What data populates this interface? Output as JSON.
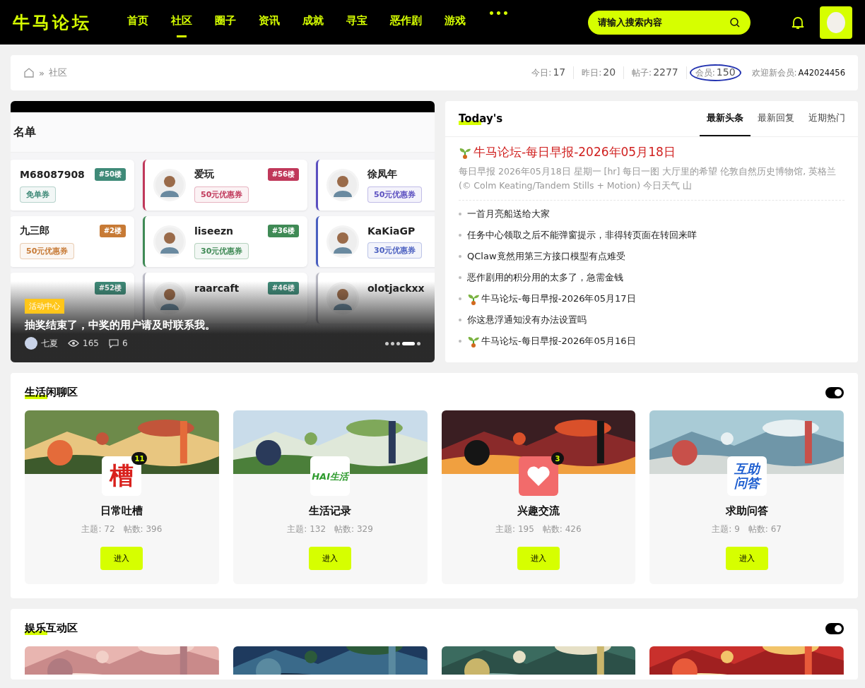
{
  "header": {
    "logo": "牛马论坛",
    "nav": [
      {
        "label": "首页",
        "selected": false
      },
      {
        "label": "社区",
        "selected": true
      },
      {
        "label": "圈子",
        "selected": false
      },
      {
        "label": "资讯",
        "selected": false
      },
      {
        "label": "成就",
        "selected": false
      },
      {
        "label": "寻宝",
        "selected": false
      },
      {
        "label": "恶作剧",
        "selected": false
      },
      {
        "label": "游戏",
        "selected": false
      }
    ],
    "more": "•••",
    "search": {
      "placeholder": "请输入搜索内容"
    }
  },
  "breadcrumb": {
    "separator": "»",
    "current": "社区"
  },
  "stats": [
    {
      "label": "今日:",
      "value": "17",
      "circled": false
    },
    {
      "label": "昨日:",
      "value": "20",
      "circled": false
    },
    {
      "label": "帖子:",
      "value": "2277",
      "circled": false
    },
    {
      "label": "会员:",
      "value": "150",
      "circled": true
    }
  ],
  "new_member": {
    "label": "欢迎新会员:",
    "value": "A42024456"
  },
  "carousel": {
    "slide_title": "名单",
    "winners": [
      {
        "name": "M68087908",
        "floor": "#50楼",
        "coupon": "免单券",
        "color": "#3f8a78",
        "avatar": false
      },
      {
        "name": "爱玩",
        "floor": "#56楼",
        "coupon": "50元优惠券",
        "color": "#c0385a",
        "avatar": true
      },
      {
        "name": "徐凤年",
        "coupon": "50元优惠券",
        "color": "#5b4fc0",
        "avatar": true
      },
      {
        "name": "九三郎",
        "floor": "#2楼",
        "coupon": "50元优惠券",
        "color": "#c77a35",
        "avatar": false
      },
      {
        "name": "liseezn",
        "floor": "#36楼",
        "coupon": "30元优惠券",
        "color": "#3f8a55",
        "avatar": true
      },
      {
        "name": "KaKiaGP",
        "coupon": "30元优惠券",
        "color": "#4a5fc0",
        "avatar": true
      },
      {
        "floor": "#52楼",
        "avatar": false
      },
      {
        "name": "raarcaft",
        "floor": "#46楼",
        "avatar": true
      },
      {
        "name": "olotjackxx",
        "avatar": true
      }
    ],
    "tag": "活动中心",
    "title": "抽奖结束了，中奖的用户请及时联系我。",
    "author": "七夏",
    "views": "165",
    "comments": "6",
    "dots": [
      {
        "selected": false
      },
      {
        "selected": false
      },
      {
        "selected": false
      },
      {
        "selected": true
      },
      {
        "selected": false
      }
    ]
  },
  "today": {
    "title": "Today's",
    "tabs": [
      {
        "label": "最新头条",
        "selected": true
      },
      {
        "label": "最新回复",
        "selected": false
      },
      {
        "label": "近期热门",
        "selected": false
      }
    ],
    "headline": {
      "title": "牛马论坛-每日早报-2026年05月18日",
      "summary": "每日早报 2026年05月18日 星期一 [hr] 每日一图 大厅里的希望 伦敦自然历史博物馆, 英格兰 (© Colm Keating/Tandem Stills + Motion) 今日天气 山"
    },
    "items": [
      {
        "title": "一首月亮船送给大家",
        "sprout": false
      },
      {
        "title": "任务中心领取之后不能弹窗提示，非得转页面在转回来咩",
        "sprout": false
      },
      {
        "title": "QClaw竟然用第三方接口模型有点难受",
        "sprout": false
      },
      {
        "title": "恶作剧用的积分用的太多了，急需金钱",
        "sprout": false
      },
      {
        "title": "牛马论坛-每日早报-2026年05月17日",
        "sprout": true
      },
      {
        "title": "你这悬浮通知没有办法设置吗",
        "sprout": false
      },
      {
        "title": "牛马论坛-每日早报-2026年05月16日",
        "sprout": true
      }
    ]
  },
  "sections": [
    {
      "title": "生活闲聊区",
      "on": true,
      "forums": [
        {
          "name": "日常吐槽",
          "kind": "char",
          "icon_text": "槽",
          "badge": "11",
          "stats": "主题: 72　帖数: 396",
          "button": "进入"
        },
        {
          "name": "生活记录",
          "kind": "logo",
          "icon_text": "HAI生活",
          "stats": "主题: 132　帖数: 329",
          "button": "进入"
        },
        {
          "name": "兴趣交流",
          "kind": "heart",
          "badge": "3",
          "stats": "主题: 195　帖数: 426",
          "button": "进入"
        },
        {
          "name": "求助问答",
          "kind": "qa",
          "icon_text": "互助问答",
          "stats": "主题: 9　帖数: 67",
          "button": "进入"
        }
      ]
    },
    {
      "title": "娱乐互动区",
      "on": true
    }
  ]
}
